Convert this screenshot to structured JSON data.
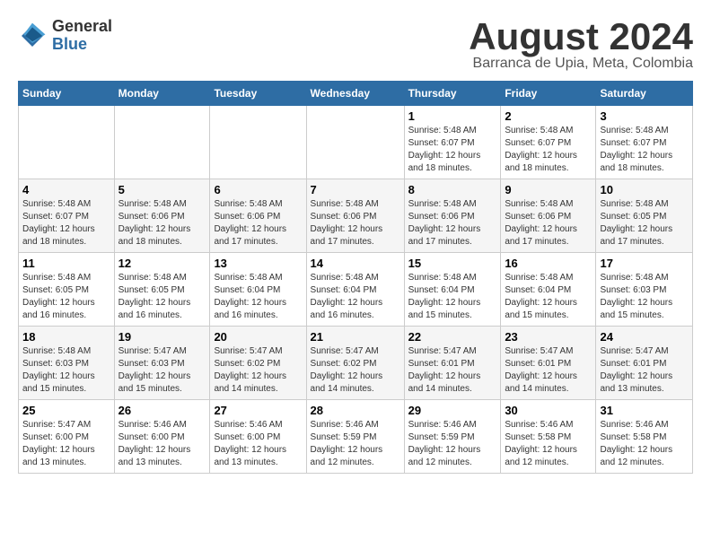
{
  "logo": {
    "general": "General",
    "blue": "Blue"
  },
  "header": {
    "month": "August 2024",
    "location": "Barranca de Upia, Meta, Colombia"
  },
  "days_of_week": [
    "Sunday",
    "Monday",
    "Tuesday",
    "Wednesday",
    "Thursday",
    "Friday",
    "Saturday"
  ],
  "weeks": [
    [
      {
        "day": "",
        "info": ""
      },
      {
        "day": "",
        "info": ""
      },
      {
        "day": "",
        "info": ""
      },
      {
        "day": "",
        "info": ""
      },
      {
        "day": "1",
        "info": "Sunrise: 5:48 AM\nSunset: 6:07 PM\nDaylight: 12 hours\nand 18 minutes."
      },
      {
        "day": "2",
        "info": "Sunrise: 5:48 AM\nSunset: 6:07 PM\nDaylight: 12 hours\nand 18 minutes."
      },
      {
        "day": "3",
        "info": "Sunrise: 5:48 AM\nSunset: 6:07 PM\nDaylight: 12 hours\nand 18 minutes."
      }
    ],
    [
      {
        "day": "4",
        "info": "Sunrise: 5:48 AM\nSunset: 6:07 PM\nDaylight: 12 hours\nand 18 minutes."
      },
      {
        "day": "5",
        "info": "Sunrise: 5:48 AM\nSunset: 6:06 PM\nDaylight: 12 hours\nand 18 minutes."
      },
      {
        "day": "6",
        "info": "Sunrise: 5:48 AM\nSunset: 6:06 PM\nDaylight: 12 hours\nand 17 minutes."
      },
      {
        "day": "7",
        "info": "Sunrise: 5:48 AM\nSunset: 6:06 PM\nDaylight: 12 hours\nand 17 minutes."
      },
      {
        "day": "8",
        "info": "Sunrise: 5:48 AM\nSunset: 6:06 PM\nDaylight: 12 hours\nand 17 minutes."
      },
      {
        "day": "9",
        "info": "Sunrise: 5:48 AM\nSunset: 6:06 PM\nDaylight: 12 hours\nand 17 minutes."
      },
      {
        "day": "10",
        "info": "Sunrise: 5:48 AM\nSunset: 6:05 PM\nDaylight: 12 hours\nand 17 minutes."
      }
    ],
    [
      {
        "day": "11",
        "info": "Sunrise: 5:48 AM\nSunset: 6:05 PM\nDaylight: 12 hours\nand 16 minutes."
      },
      {
        "day": "12",
        "info": "Sunrise: 5:48 AM\nSunset: 6:05 PM\nDaylight: 12 hours\nand 16 minutes."
      },
      {
        "day": "13",
        "info": "Sunrise: 5:48 AM\nSunset: 6:04 PM\nDaylight: 12 hours\nand 16 minutes."
      },
      {
        "day": "14",
        "info": "Sunrise: 5:48 AM\nSunset: 6:04 PM\nDaylight: 12 hours\nand 16 minutes."
      },
      {
        "day": "15",
        "info": "Sunrise: 5:48 AM\nSunset: 6:04 PM\nDaylight: 12 hours\nand 15 minutes."
      },
      {
        "day": "16",
        "info": "Sunrise: 5:48 AM\nSunset: 6:04 PM\nDaylight: 12 hours\nand 15 minutes."
      },
      {
        "day": "17",
        "info": "Sunrise: 5:48 AM\nSunset: 6:03 PM\nDaylight: 12 hours\nand 15 minutes."
      }
    ],
    [
      {
        "day": "18",
        "info": "Sunrise: 5:48 AM\nSunset: 6:03 PM\nDaylight: 12 hours\nand 15 minutes."
      },
      {
        "day": "19",
        "info": "Sunrise: 5:47 AM\nSunset: 6:03 PM\nDaylight: 12 hours\nand 15 minutes."
      },
      {
        "day": "20",
        "info": "Sunrise: 5:47 AM\nSunset: 6:02 PM\nDaylight: 12 hours\nand 14 minutes."
      },
      {
        "day": "21",
        "info": "Sunrise: 5:47 AM\nSunset: 6:02 PM\nDaylight: 12 hours\nand 14 minutes."
      },
      {
        "day": "22",
        "info": "Sunrise: 5:47 AM\nSunset: 6:01 PM\nDaylight: 12 hours\nand 14 minutes."
      },
      {
        "day": "23",
        "info": "Sunrise: 5:47 AM\nSunset: 6:01 PM\nDaylight: 12 hours\nand 14 minutes."
      },
      {
        "day": "24",
        "info": "Sunrise: 5:47 AM\nSunset: 6:01 PM\nDaylight: 12 hours\nand 13 minutes."
      }
    ],
    [
      {
        "day": "25",
        "info": "Sunrise: 5:47 AM\nSunset: 6:00 PM\nDaylight: 12 hours\nand 13 minutes."
      },
      {
        "day": "26",
        "info": "Sunrise: 5:46 AM\nSunset: 6:00 PM\nDaylight: 12 hours\nand 13 minutes."
      },
      {
        "day": "27",
        "info": "Sunrise: 5:46 AM\nSunset: 6:00 PM\nDaylight: 12 hours\nand 13 minutes."
      },
      {
        "day": "28",
        "info": "Sunrise: 5:46 AM\nSunset: 5:59 PM\nDaylight: 12 hours\nand 12 minutes."
      },
      {
        "day": "29",
        "info": "Sunrise: 5:46 AM\nSunset: 5:59 PM\nDaylight: 12 hours\nand 12 minutes."
      },
      {
        "day": "30",
        "info": "Sunrise: 5:46 AM\nSunset: 5:58 PM\nDaylight: 12 hours\nand 12 minutes."
      },
      {
        "day": "31",
        "info": "Sunrise: 5:46 AM\nSunset: 5:58 PM\nDaylight: 12 hours\nand 12 minutes."
      }
    ]
  ]
}
